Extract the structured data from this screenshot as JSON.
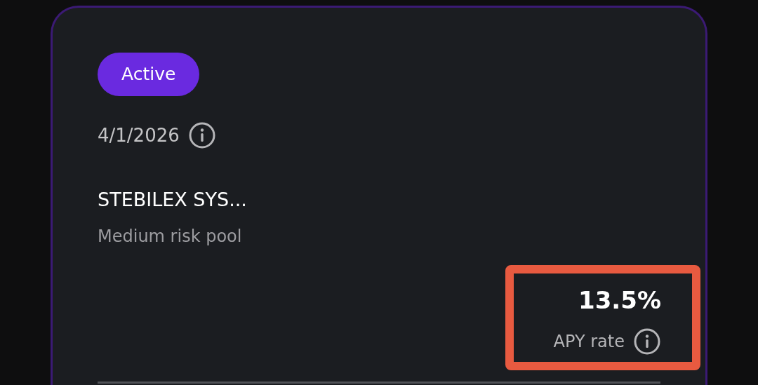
{
  "pool": {
    "status": "Active",
    "selected": true,
    "date": "4/1/2026",
    "name": "STEBILEX SYS...",
    "subtitle": "Medium risk pool",
    "rate": {
      "value": "13.5%",
      "label": "APY rate",
      "highlighted": true
    }
  }
}
